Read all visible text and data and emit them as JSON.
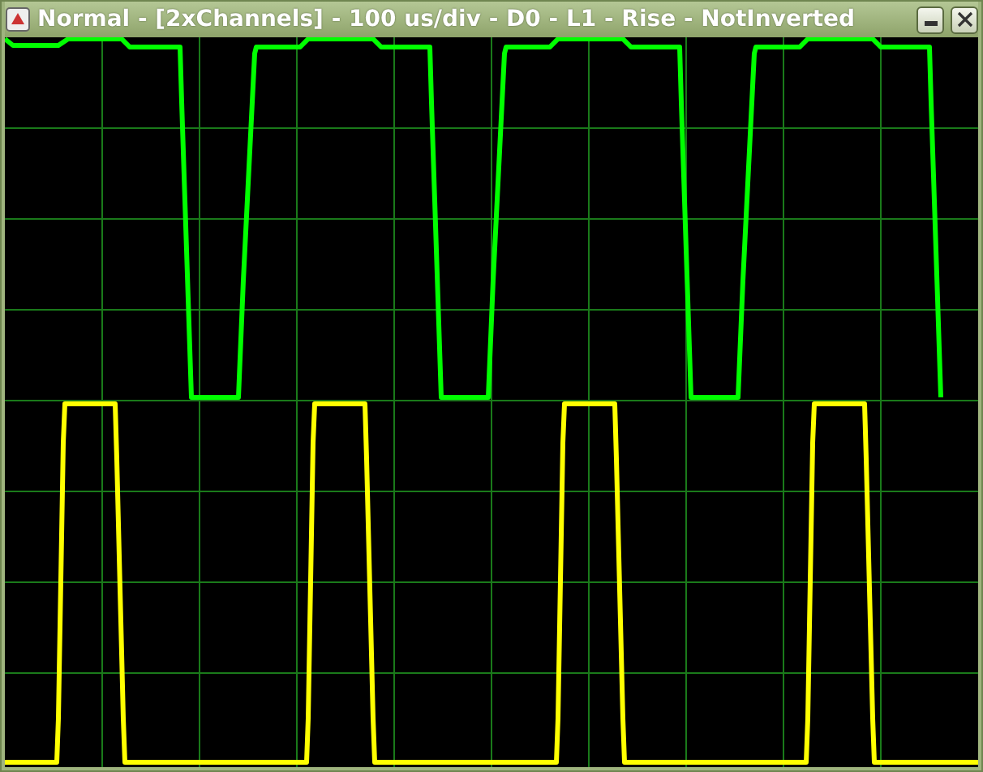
{
  "window": {
    "title": "Normal - [2xChannels] - 100 us/div - D0 - L1 - Rise - NotInverted"
  },
  "channels": [
    {
      "color": "#00ff00"
    },
    {
      "color": "#ffff00"
    }
  ]
}
